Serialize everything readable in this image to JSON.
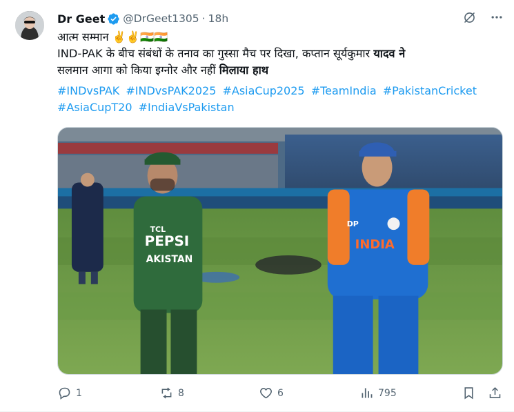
{
  "author": {
    "name": "Dr Geet",
    "handle": "@DrGeet1305",
    "separator": "·",
    "time": "18h"
  },
  "tweet": {
    "line1": "आत्म सम्मान ✌️✌️🇮🇳🇮🇳",
    "line2_plain": "IND-PAK के बीच संबंधों के तनाव का गुस्सा मैच पर दिखा, कप्तान सूर्यकुमार ",
    "line2_bold": "यादव ने",
    "line3_plain": "सलमान आगा को किया इग्नोर और नहीं ",
    "line3_bold": "मिलाया हाथ",
    "hashtags": [
      "#INDvsPAK",
      "#INDvsPAK2025",
      "#AsiaCup2025",
      "#TeamIndia",
      "#PakistanCricket",
      "#AsiaCupT20",
      "#IndiaVsPakistan"
    ]
  },
  "media": {
    "left_jersey_brand": "PEPSI",
    "left_jersey_sponsor": "TCL",
    "left_jersey_team": "AKISTAN",
    "right_jersey_team": "INDIA",
    "right_jersey_sponsor": "DP"
  },
  "actions": {
    "reply_count": "1",
    "retweet_count": "8",
    "like_count": "6",
    "view_count": "795"
  },
  "colors": {
    "link": "#1d9bf0",
    "muted": "#536471",
    "verified": "#1d9bf0"
  }
}
